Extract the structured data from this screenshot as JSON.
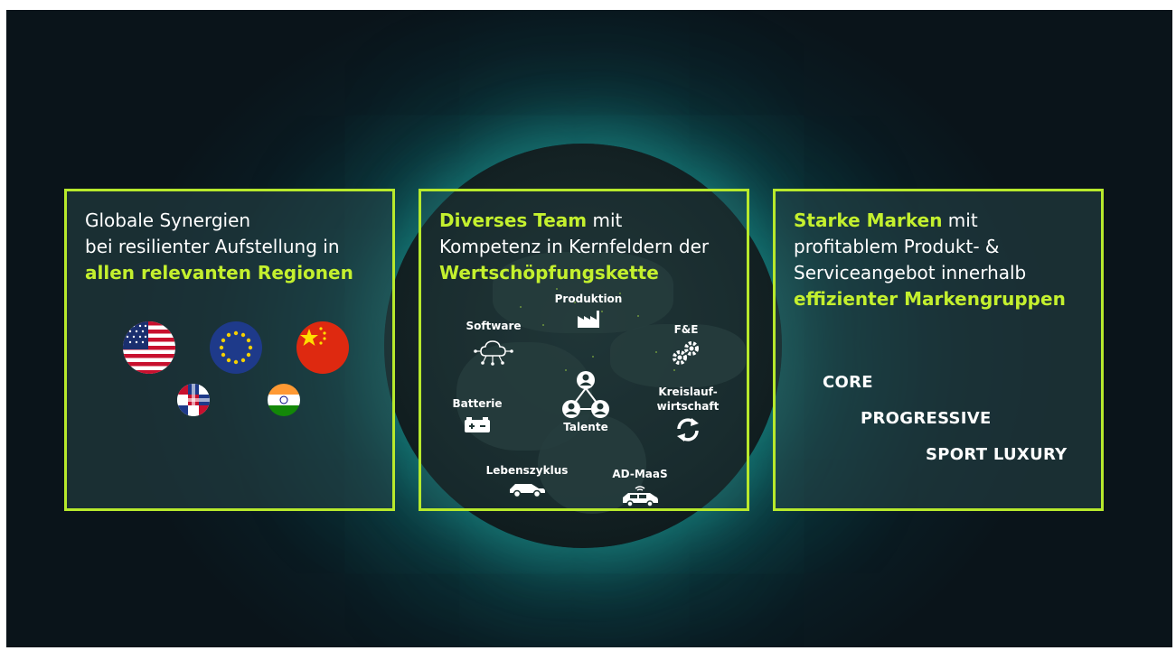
{
  "panels": [
    {
      "line1": "Globale Synergien",
      "line2": "bei resilienter Aufstellung in",
      "highlight": "allen relevanten Regionen",
      "flags": [
        "usa-flag",
        "eu-flag",
        "china-flag",
        "multi-flag",
        "india-flag"
      ]
    },
    {
      "highlight1": "Diverses Team",
      "rest1": " mit",
      "line2": "Kompetenz in Kernfeldern der",
      "highlight3": "Wertschöpfungskette",
      "items": {
        "produktion": "Produktion",
        "software": "Software",
        "fe": "F&E",
        "batterie": "Batterie",
        "talente": "Talente",
        "kreislauf1": "Kreislauf-",
        "kreislauf2": "wirtschaft",
        "lebenszyklus": "Lebenszyklus",
        "admaas": "AD-MaaS"
      }
    },
    {
      "highlight1": "Starke Marken",
      "rest1": " mit",
      "line2": "profitablem Produkt- &",
      "line3": "Serviceangebot innerhalb",
      "highlight4": "effizienter Markengruppen",
      "brands": [
        "CORE",
        "PROGRESSIVE",
        "SPORT LUXURY"
      ]
    }
  ],
  "colors": {
    "accent": "#b7e92c",
    "highlight_text": "#c4f02e",
    "background": "#0a1b22"
  }
}
